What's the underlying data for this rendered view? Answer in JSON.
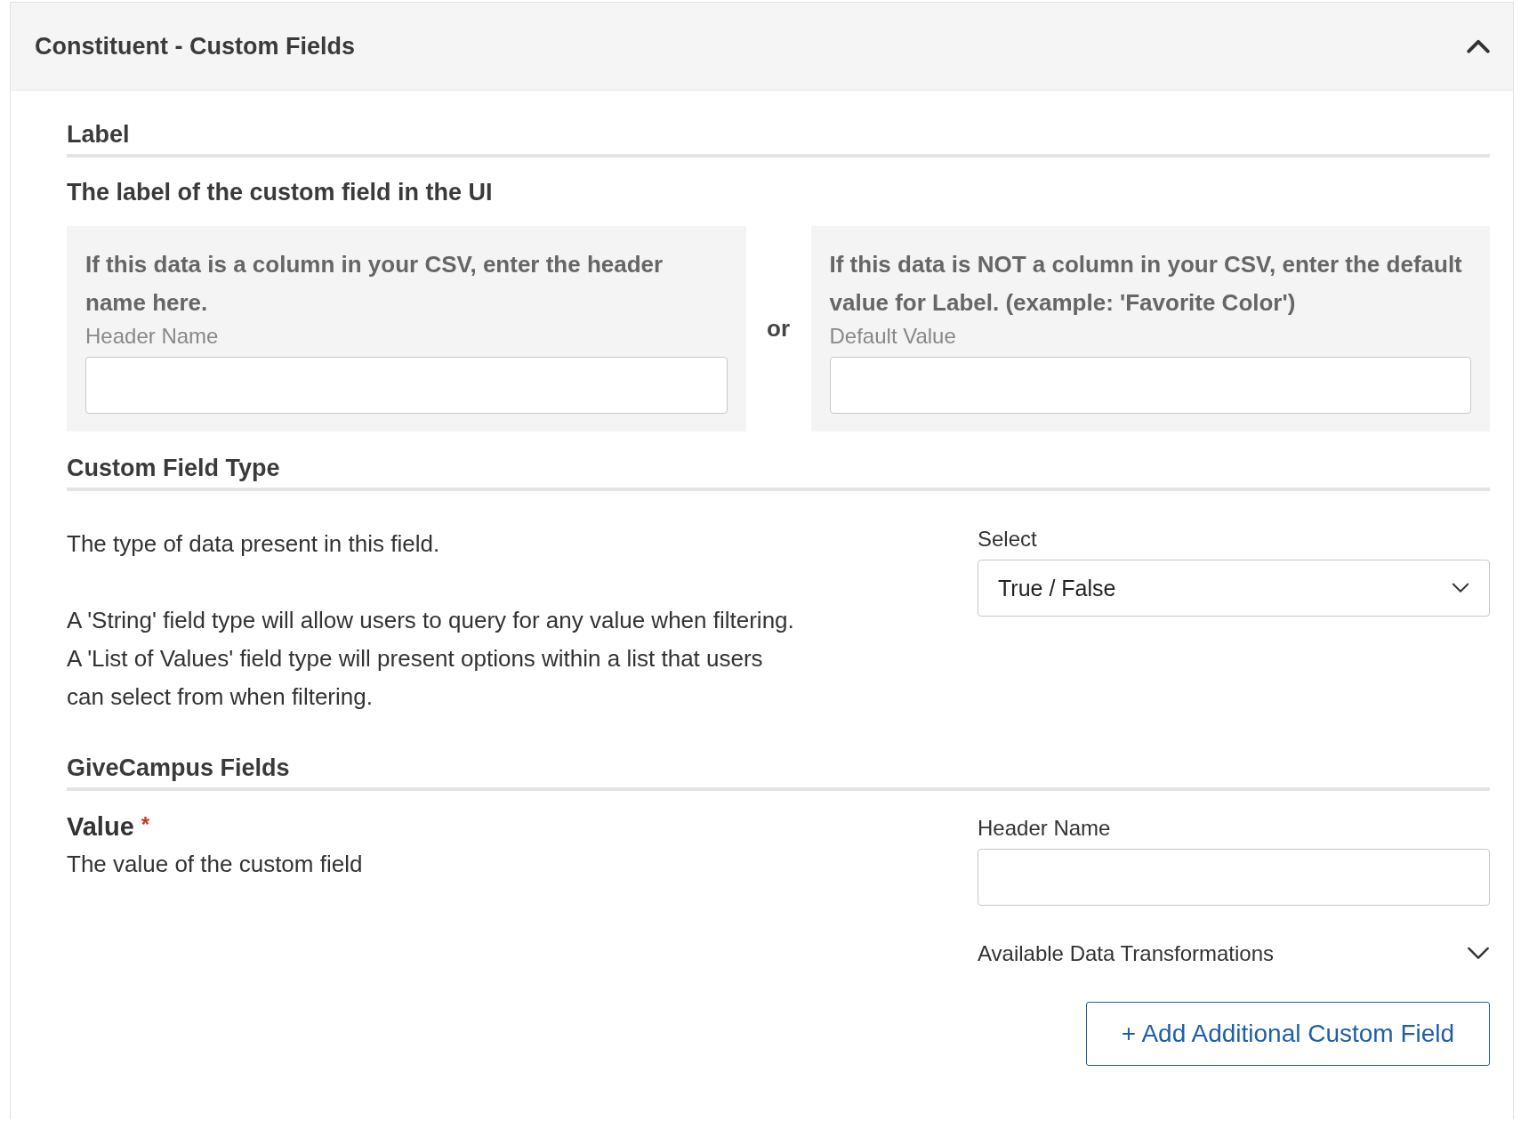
{
  "panel": {
    "title": "Constituent - Custom Fields",
    "expanded": true
  },
  "label_section": {
    "heading": "Label",
    "subheading": "The label of the custom field in the UI",
    "left_option": {
      "text": "If this data is a column in your CSV, enter the header name here.",
      "field_label": "Header Name"
    },
    "separator": "or",
    "right_option": {
      "text": "If this data is NOT a column in your CSV, enter the default value for Label. (example: 'Favorite Color')",
      "field_label": "Default Value"
    }
  },
  "type_section": {
    "heading": "Custom Field Type",
    "paragraphs": [
      "The type of data present in this field.",
      "A 'String' field type will allow users to query for any value when filtering. A 'List of Values' field type will present options within a list that users can select from when filtering."
    ],
    "select_label": "Select",
    "select_value": "True / False"
  },
  "givecampus_section": {
    "heading": "GiveCampus Fields",
    "field_title": "Value",
    "required": true,
    "required_mark": "*",
    "field_description": "The value of the custom field",
    "input_label": "Header Name",
    "transformations": {
      "label": "Available Data Transformations",
      "expanded": false
    },
    "add_button": "+ Add Additional Custom Field"
  }
}
